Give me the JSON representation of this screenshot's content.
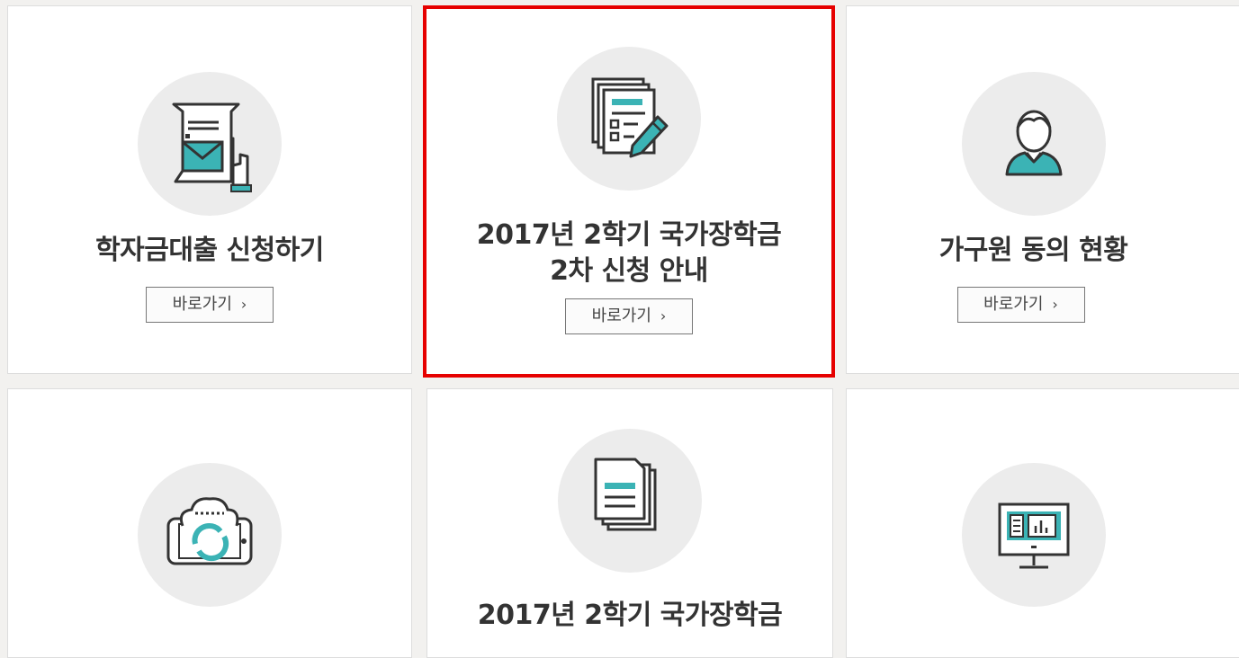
{
  "cards": [
    {
      "title_lines": [
        "학자금대출 신청하기"
      ],
      "button": "바로가기",
      "chevron": "›",
      "icon": "loan-application-icon"
    },
    {
      "title_lines": [
        "2017년 2학기 국가장학금",
        "2차 신청 안내"
      ],
      "button": "바로가기",
      "chevron": "›",
      "icon": "document-edit-icon",
      "highlighted": true
    },
    {
      "title_lines": [
        "가구원 동의 현황"
      ],
      "button": "바로가기",
      "chevron": "›",
      "icon": "person-icon"
    },
    {
      "title_lines": [],
      "button": "",
      "icon": "cloud-sync-icon"
    },
    {
      "title_lines": [
        "2017년 2학기 국가장학금"
      ],
      "button": "",
      "icon": "documents-icon"
    },
    {
      "title_lines": [],
      "button": "",
      "icon": "monitor-icon"
    }
  ],
  "colors": {
    "accent": "#3bb3b5",
    "dark": "#333333",
    "highlight": "#e60000"
  }
}
